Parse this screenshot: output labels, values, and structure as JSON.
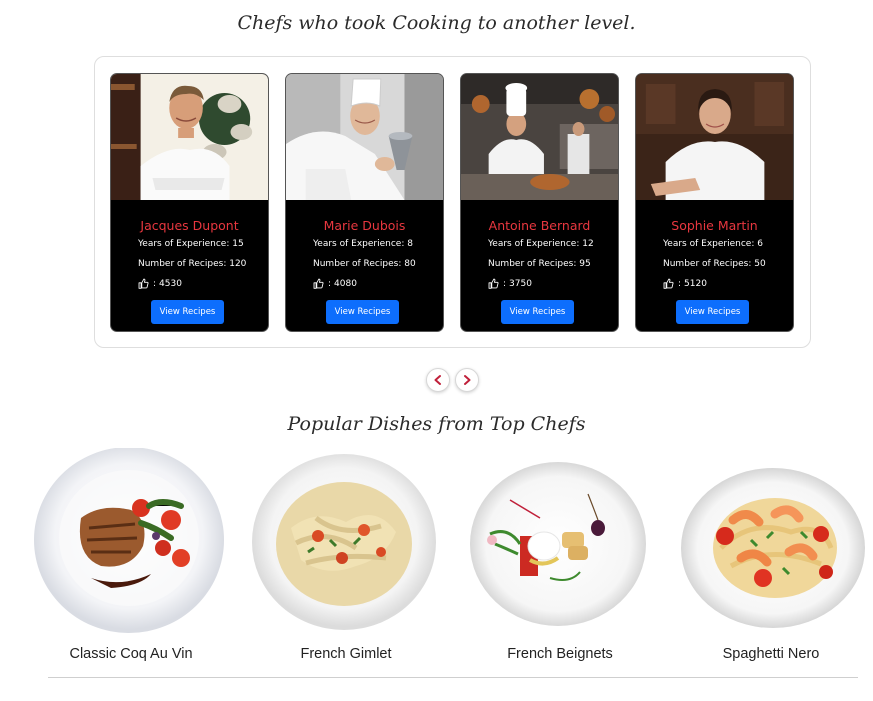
{
  "sections": {
    "chefs_title": "Chefs who took Cooking to another level.",
    "dishes_title": "Popular Dishes from Top Chefs"
  },
  "chefs": [
    {
      "name": "Jacques Dupont",
      "experience": "Years of Experience: 15",
      "recipes": "Number of Recipes: 120",
      "likes": "4530",
      "button": "View Recipes"
    },
    {
      "name": "Marie Dubois",
      "experience": "Years of Experience: 8",
      "recipes": "Number of Recipes: 80",
      "likes": "4080",
      "button": "View Recipes"
    },
    {
      "name": "Antoine Bernard",
      "experience": "Years of Experience: 12",
      "recipes": "Number of Recipes: 95",
      "likes": "3750",
      "button": "View Recipes"
    },
    {
      "name": "Sophie Martin",
      "experience": "Years of Experience: 6",
      "recipes": "Number of Recipes: 50",
      "likes": "5120",
      "button": "View Recipes"
    }
  ],
  "likes_separator": ":",
  "carousel": {
    "prev_label": "<",
    "next_label": ">"
  },
  "dishes": [
    {
      "name": "Classic Coq Au Vin"
    },
    {
      "name": "French Gimlet"
    },
    {
      "name": "French Beignets"
    },
    {
      "name": "Spaghetti Nero"
    }
  ],
  "colors": {
    "accent_button": "#0d6efd",
    "chef_name": "#e8373f",
    "card_background": "#000000",
    "nav_arrow": "#c0203a"
  },
  "icons": {
    "likes": "thumbs-up-icon",
    "prev": "chevron-left-icon",
    "next": "chevron-right-icon"
  }
}
